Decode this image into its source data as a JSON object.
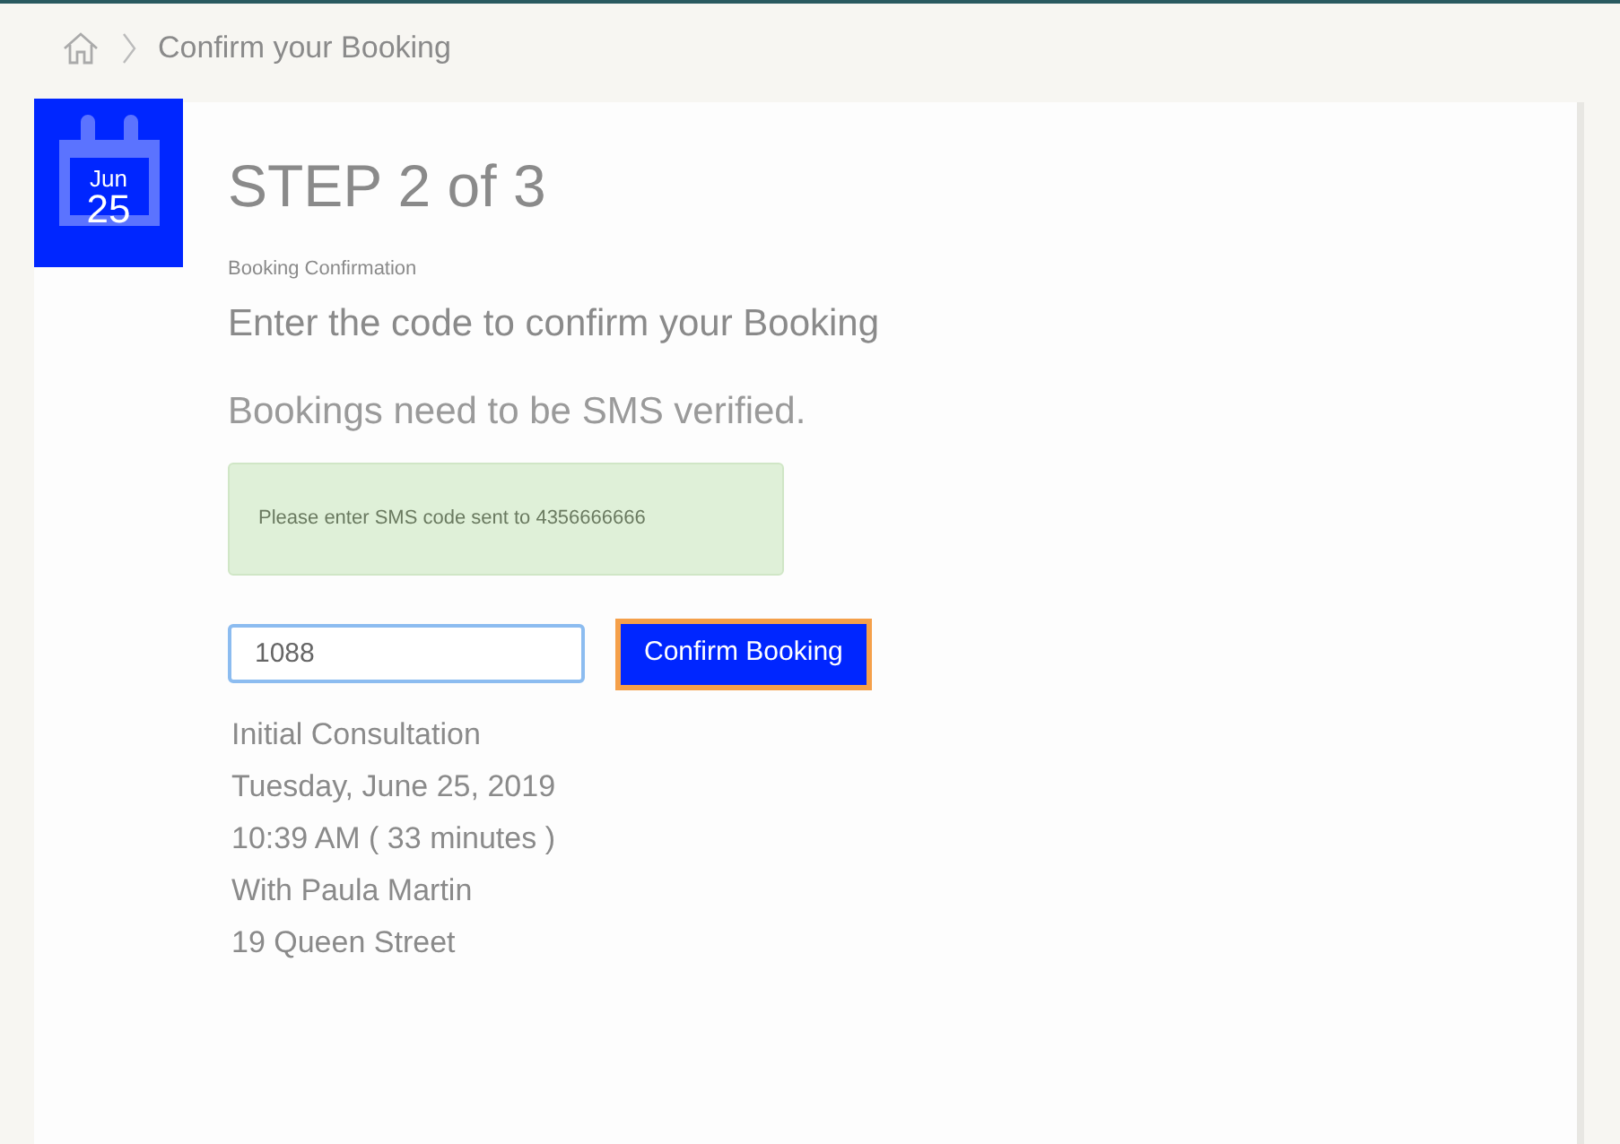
{
  "breadcrumb": {
    "current": "Confirm your Booking"
  },
  "date_badge": {
    "month": "Jun",
    "day": "25"
  },
  "step_title": "STEP 2 of 3",
  "section_label": "Booking Confirmation",
  "heading": "Enter the code to confirm your Booking",
  "subheading": "Bookings need to be SMS verified.",
  "alert": "Please enter SMS code sent to 4356666666",
  "code_field": {
    "value": "1088"
  },
  "confirm_button": "Confirm Booking",
  "details": [
    "Initial Consultation",
    "Tuesday, June 25, 2019",
    "10:39 AM ( 33 minutes )",
    "With Paula Martin",
    "19 Queen Street"
  ]
}
